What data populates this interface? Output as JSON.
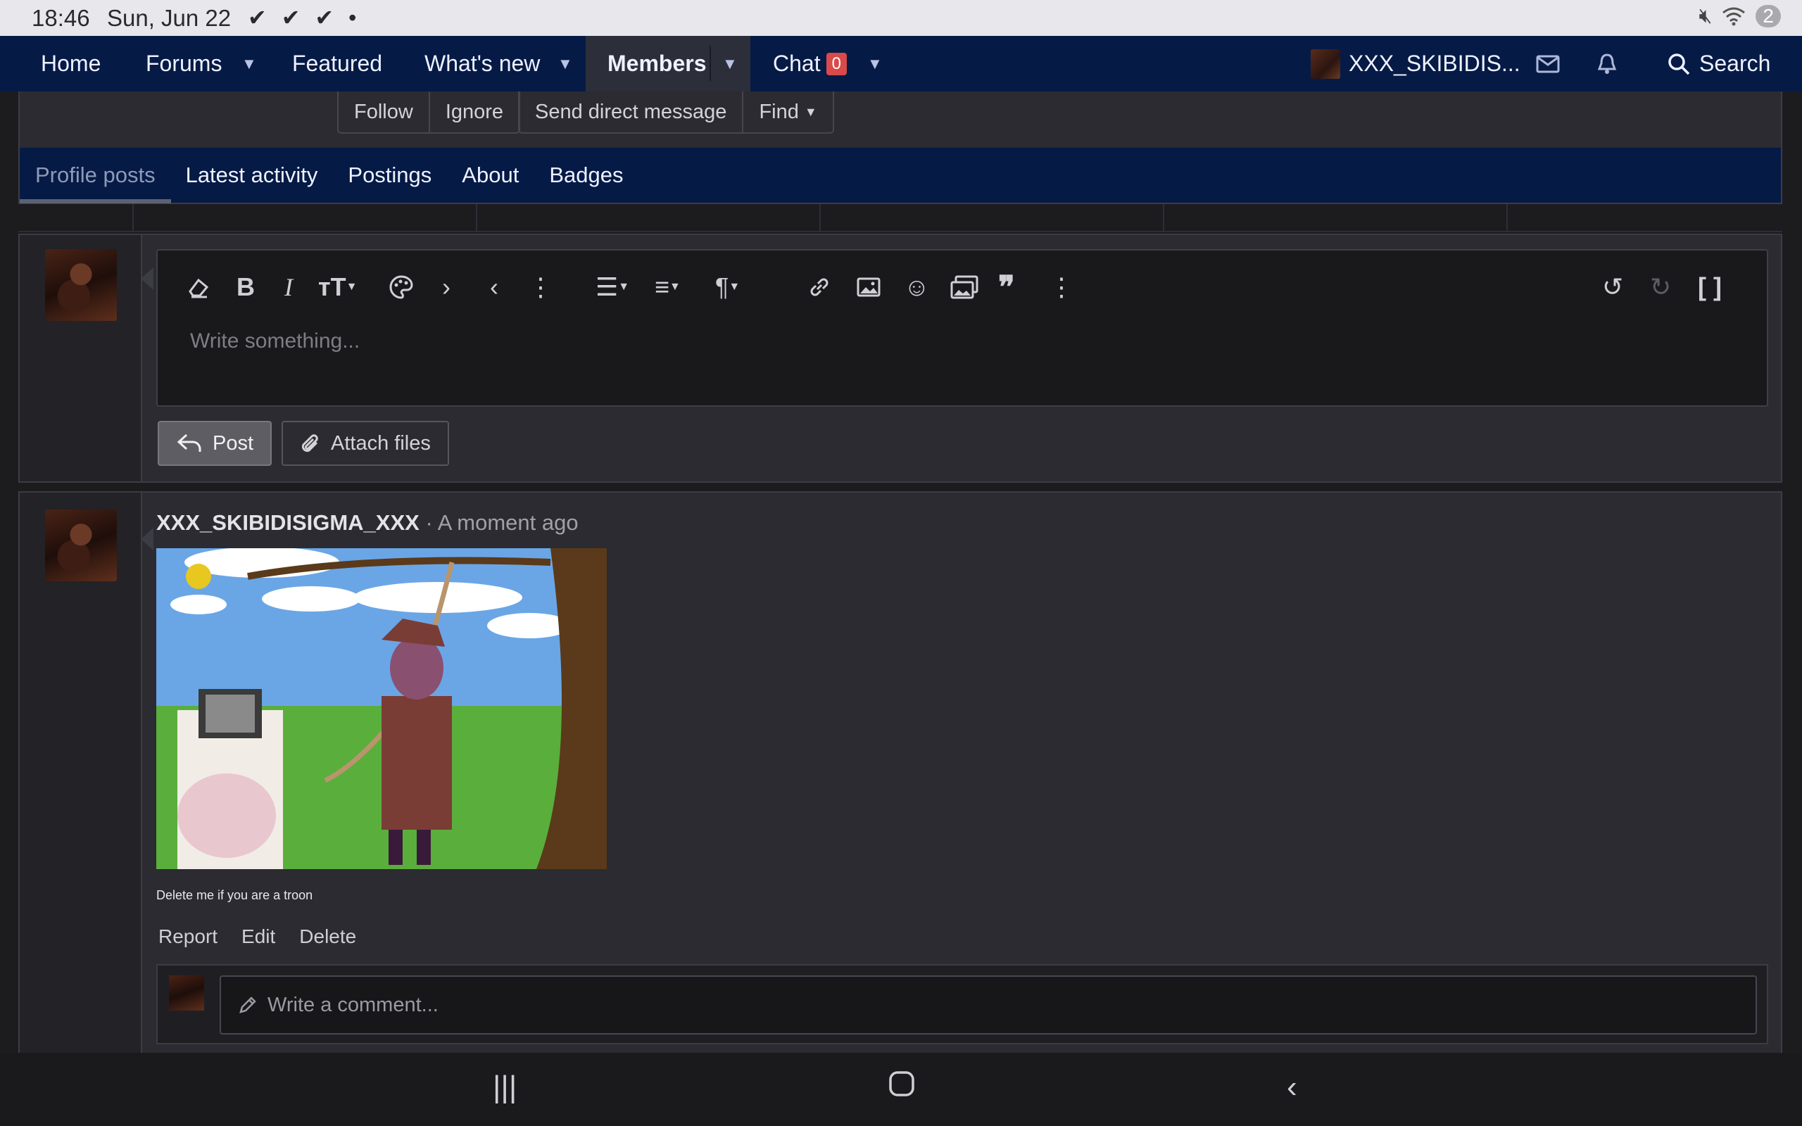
{
  "status_bar": {
    "time": "18:46",
    "date": "Sun, Jun 22",
    "checks": "✔ ✔ ✔ •",
    "notification_count": "2"
  },
  "topnav": {
    "home": "Home",
    "forums": "Forums",
    "featured": "Featured",
    "whats_new": "What's new",
    "members": "Members",
    "chat": "Chat",
    "chat_count": "0",
    "username": "XXX_SKIBIDIS...",
    "search": "Search"
  },
  "profile_buttons": {
    "follow": "Follow",
    "ignore": "Ignore",
    "send_dm": "Send direct message",
    "find": "Find"
  },
  "tabs": [
    {
      "label": "Profile posts"
    },
    {
      "label": "Latest activity"
    },
    {
      "label": "Postings"
    },
    {
      "label": "About"
    },
    {
      "label": "Badges"
    }
  ],
  "editor": {
    "placeholder": "Write something..."
  },
  "composer_buttons": {
    "post": "Post",
    "attach": "Attach files"
  },
  "post": {
    "author": "XXX_SKIBIDISIGMA_XXX",
    "separator": " · ",
    "time": "A moment ago",
    "caption": "Delete me if you are a troon",
    "actions": {
      "report": "Report",
      "edit": "Edit",
      "delete": "Delete"
    }
  },
  "comment": {
    "placeholder": "Write a comment..."
  },
  "colors": {
    "nav_bg": "#061a46",
    "page_bg": "#1c1c1f",
    "block_bg": "#2b2b31",
    "badge_red": "#d94a4a"
  }
}
